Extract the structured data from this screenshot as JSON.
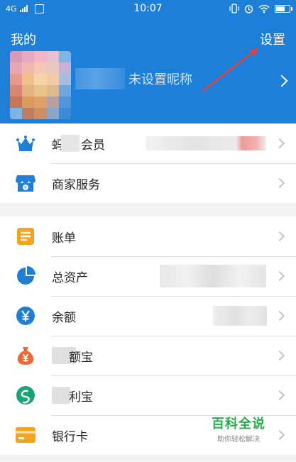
{
  "status_bar": {
    "network": "4G",
    "time": "10:07"
  },
  "header": {
    "title": "我的",
    "settings_label": "设置",
    "nickname": "未设置昵称"
  },
  "section1": {
    "items": [
      {
        "label": "会员",
        "prefix": "蚂",
        "icon": "crown-icon"
      },
      {
        "label": "商家服务",
        "icon": "store-icon"
      }
    ]
  },
  "section2": {
    "items": [
      {
        "label": "账单",
        "icon": "bill-icon"
      },
      {
        "label": "总资产",
        "icon": "pie-chart-icon"
      },
      {
        "label": "余额",
        "icon": "yuan-coin-icon"
      },
      {
        "label": "额宝",
        "icon": "money-bag-icon"
      },
      {
        "label": "利宝",
        "icon": "swirl-icon"
      },
      {
        "label": "银行卡",
        "icon": "bank-card-icon"
      }
    ]
  },
  "watermark": {
    "main": "百科全说",
    "sub": "助你轻松解决"
  },
  "colors": {
    "header_bg": "#1e7fd9",
    "annotation_arrow": "#e8413a",
    "watermark_green": "#27ad4b"
  }
}
